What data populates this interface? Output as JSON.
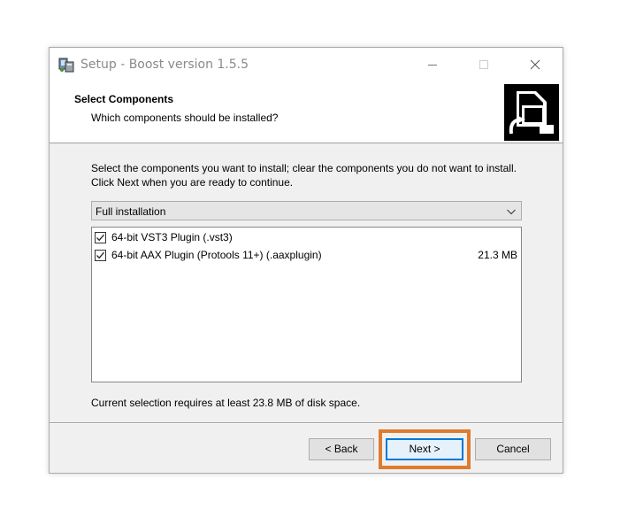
{
  "window": {
    "title": "Setup - Boost version 1.5.5"
  },
  "header": {
    "title": "Select Components",
    "subtitle": "Which components should be installed?"
  },
  "main": {
    "description": "Select the components you want to install; clear the components you do not want to install. Click Next when you are ready to continue.",
    "installation_type": "Full installation",
    "components": [
      {
        "label": "64-bit VST3 Plugin (.vst3)",
        "size": "",
        "checked": true
      },
      {
        "label": "64-bit AAX Plugin (Protools 11+) (.aaxplugin)",
        "size": "21.3 MB",
        "checked": true
      }
    ],
    "disk_space_text": "Current selection requires at least 23.8 MB of disk space."
  },
  "buttons": {
    "back": "< Back",
    "next": "Next >",
    "cancel": "Cancel"
  },
  "colors": {
    "highlight": "#e07b2e",
    "focus": "#0078d7"
  },
  "icons": [
    "setup-app-icon",
    "minimize-icon",
    "maximize-icon",
    "close-icon",
    "installer-logo-icon",
    "chevron-down-icon",
    "checkmark-icon"
  ]
}
